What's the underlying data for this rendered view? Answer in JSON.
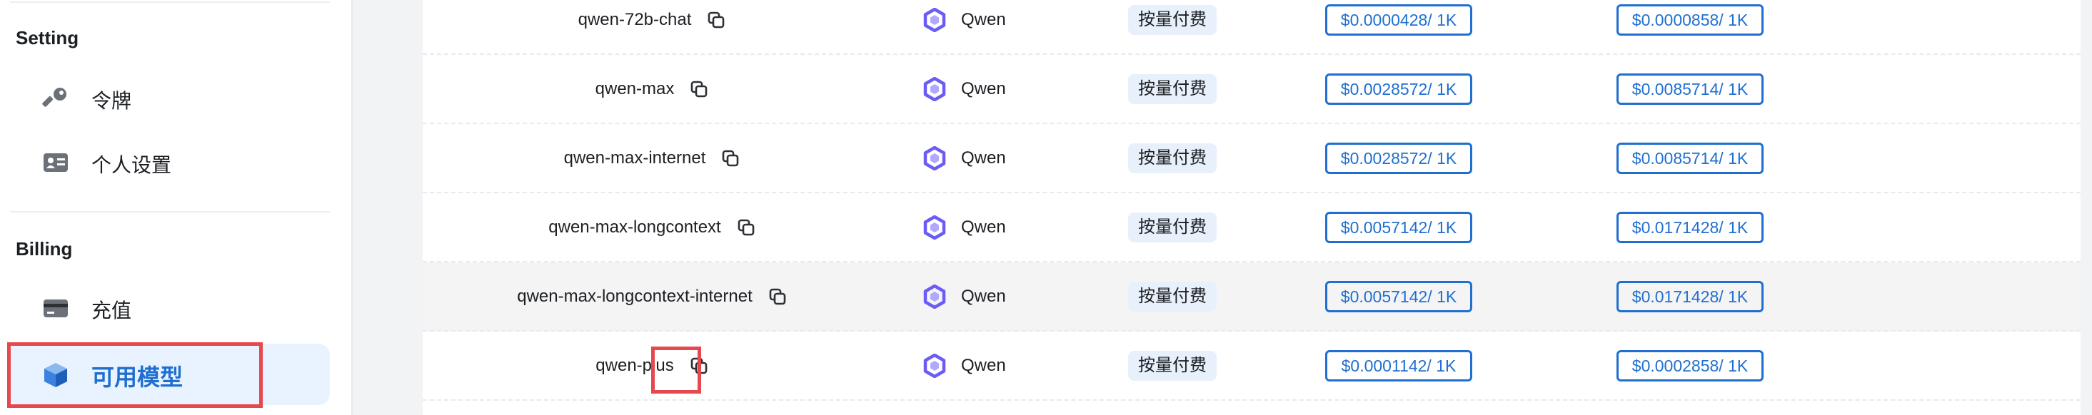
{
  "sidebar": {
    "setting_title": "Setting",
    "setting_items": [
      {
        "label": "令牌",
        "icon": "key-icon"
      },
      {
        "label": "个人设置",
        "icon": "id-card-icon"
      }
    ],
    "billing_title": "Billing",
    "billing_items": [
      {
        "label": "充值",
        "icon": "credit-card-icon"
      },
      {
        "label": "可用模型",
        "icon": "cube-icon",
        "active": true
      }
    ]
  },
  "models": [
    {
      "name": "qwen-72b-chat",
      "vendor": "Qwen",
      "billing": "按量付费",
      "input_price": "$0.0000428/ 1K",
      "output_price": "$0.0000858/ 1K"
    },
    {
      "name": "qwen-max",
      "vendor": "Qwen",
      "billing": "按量付费",
      "input_price": "$0.0028572/ 1K",
      "output_price": "$0.0085714/ 1K"
    },
    {
      "name": "qwen-max-internet",
      "vendor": "Qwen",
      "billing": "按量付费",
      "input_price": "$0.0028572/ 1K",
      "output_price": "$0.0085714/ 1K"
    },
    {
      "name": "qwen-max-longcontext",
      "vendor": "Qwen",
      "billing": "按量付费",
      "input_price": "$0.0057142/ 1K",
      "output_price": "$0.0171428/ 1K"
    },
    {
      "name": "qwen-max-longcontext-internet",
      "vendor": "Qwen",
      "billing": "按量付费",
      "input_price": "$0.0057142/ 1K",
      "output_price": "$0.0171428/ 1K"
    },
    {
      "name": "qwen-plus",
      "vendor": "Qwen",
      "billing": "按量付费",
      "input_price": "$0.0001142/ 1K",
      "output_price": "$0.0002858/ 1K"
    }
  ],
  "colors": {
    "accent": "#1f6fd1",
    "highlight": "#e5484d",
    "active_bg": "#e9f2ff",
    "tag_bg": "#e8f1fb",
    "vendor_icon": "#6b5cf6"
  }
}
